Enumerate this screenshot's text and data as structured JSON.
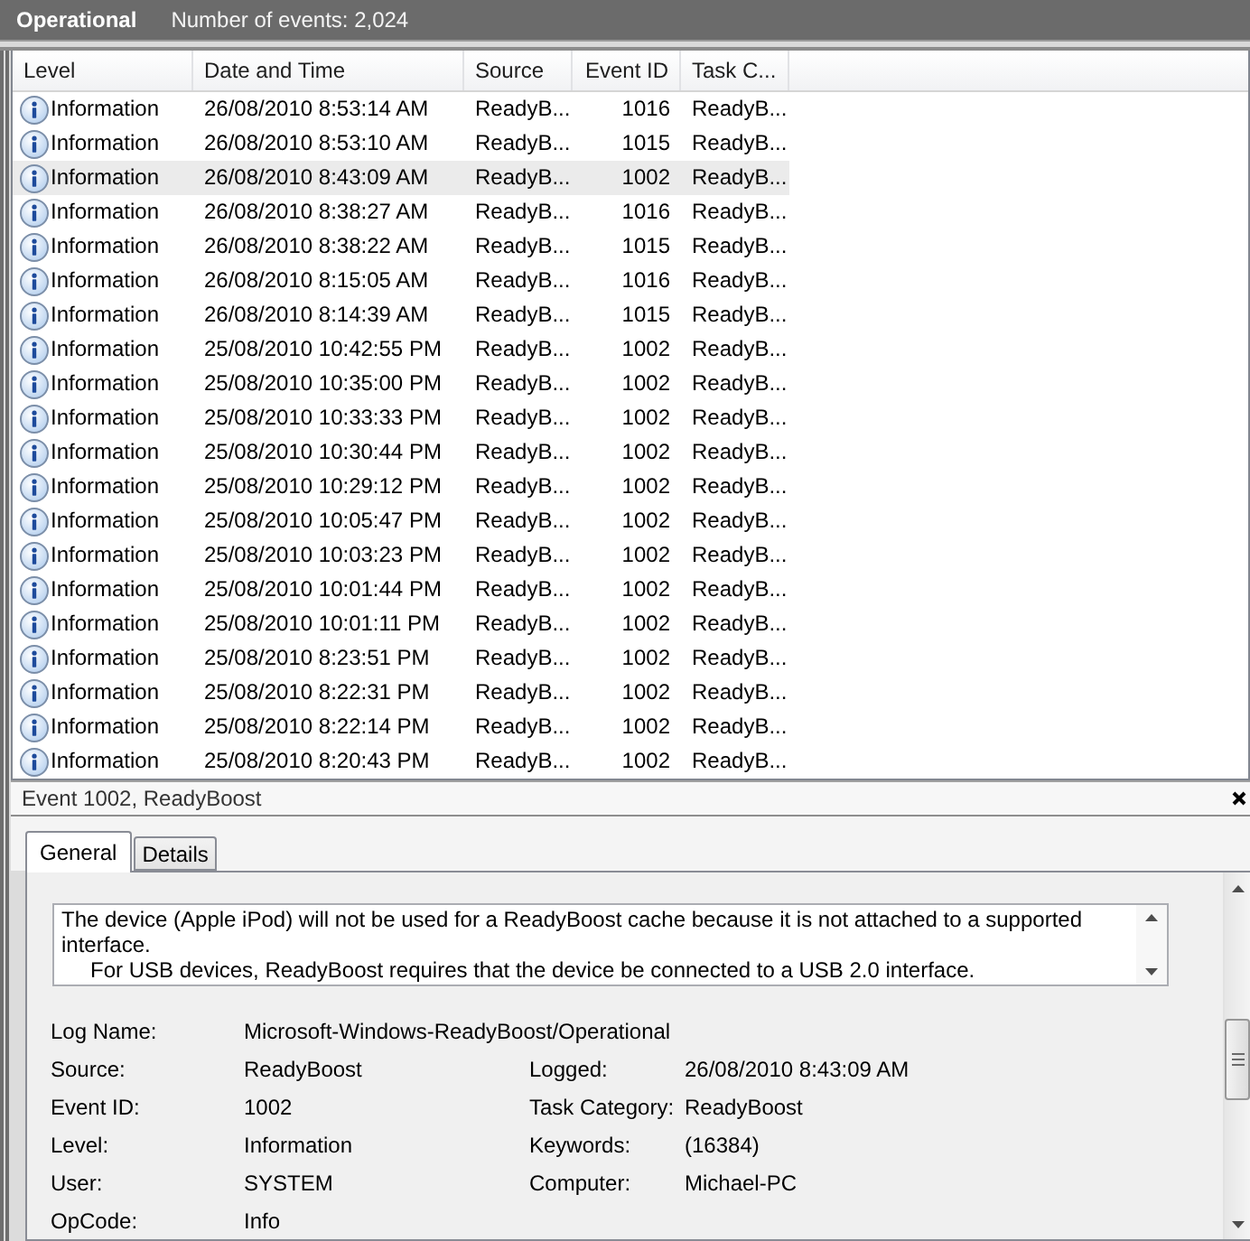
{
  "log_header": {
    "title": "Operational",
    "event_count": "Number of events: 2,024"
  },
  "events_table": {
    "columns": [
      "Level",
      "Date and Time",
      "Source",
      "Event ID",
      "Task C..."
    ],
    "rows": [
      {
        "cells": [
          "Information",
          "26/08/2010 8:53:14 AM",
          "ReadyB...",
          "1016",
          "ReadyB..."
        ],
        "selected": false
      },
      {
        "cells": [
          "Information",
          "26/08/2010 8:53:10 AM",
          "ReadyB...",
          "1015",
          "ReadyB..."
        ],
        "selected": false
      },
      {
        "cells": [
          "Information",
          "26/08/2010 8:43:09 AM",
          "ReadyB...",
          "1002",
          "ReadyB..."
        ],
        "selected": true
      },
      {
        "cells": [
          "Information",
          "26/08/2010 8:38:27 AM",
          "ReadyB...",
          "1016",
          "ReadyB..."
        ],
        "selected": false
      },
      {
        "cells": [
          "Information",
          "26/08/2010 8:38:22 AM",
          "ReadyB...",
          "1015",
          "ReadyB..."
        ],
        "selected": false
      },
      {
        "cells": [
          "Information",
          "26/08/2010 8:15:05 AM",
          "ReadyB...",
          "1016",
          "ReadyB..."
        ],
        "selected": false
      },
      {
        "cells": [
          "Information",
          "26/08/2010 8:14:39 AM",
          "ReadyB...",
          "1015",
          "ReadyB..."
        ],
        "selected": false
      },
      {
        "cells": [
          "Information",
          "25/08/2010 10:42:55 PM",
          "ReadyB...",
          "1002",
          "ReadyB..."
        ],
        "selected": false
      },
      {
        "cells": [
          "Information",
          "25/08/2010 10:35:00 PM",
          "ReadyB...",
          "1002",
          "ReadyB..."
        ],
        "selected": false
      },
      {
        "cells": [
          "Information",
          "25/08/2010 10:33:33 PM",
          "ReadyB...",
          "1002",
          "ReadyB..."
        ],
        "selected": false
      },
      {
        "cells": [
          "Information",
          "25/08/2010 10:30:44 PM",
          "ReadyB...",
          "1002",
          "ReadyB..."
        ],
        "selected": false
      },
      {
        "cells": [
          "Information",
          "25/08/2010 10:29:12 PM",
          "ReadyB...",
          "1002",
          "ReadyB..."
        ],
        "selected": false
      },
      {
        "cells": [
          "Information",
          "25/08/2010 10:05:47 PM",
          "ReadyB...",
          "1002",
          "ReadyB..."
        ],
        "selected": false
      },
      {
        "cells": [
          "Information",
          "25/08/2010 10:03:23 PM",
          "ReadyB...",
          "1002",
          "ReadyB..."
        ],
        "selected": false
      },
      {
        "cells": [
          "Information",
          "25/08/2010 10:01:44 PM",
          "ReadyB...",
          "1002",
          "ReadyB..."
        ],
        "selected": false
      },
      {
        "cells": [
          "Information",
          "25/08/2010 10:01:11 PM",
          "ReadyB...",
          "1002",
          "ReadyB..."
        ],
        "selected": false
      },
      {
        "cells": [
          "Information",
          "25/08/2010 8:23:51 PM",
          "ReadyB...",
          "1002",
          "ReadyB..."
        ],
        "selected": false
      },
      {
        "cells": [
          "Information",
          "25/08/2010 8:22:31 PM",
          "ReadyB...",
          "1002",
          "ReadyB..."
        ],
        "selected": false
      },
      {
        "cells": [
          "Information",
          "25/08/2010 8:22:14 PM",
          "ReadyB...",
          "1002",
          "ReadyB..."
        ],
        "selected": false
      },
      {
        "cells": [
          "Information",
          "25/08/2010 8:20:43 PM",
          "ReadyB...",
          "1002",
          "ReadyB..."
        ],
        "selected": false
      }
    ]
  },
  "event_details": {
    "title": "Event 1002, ReadyBoost",
    "tabs": [
      {
        "label": "General",
        "selected": true
      },
      {
        "label": "Details",
        "selected": false
      }
    ],
    "description": [
      "The device (Apple iPod) will not be used for a ReadyBoost cache because it is not attached to a supported interface.",
      "For USB devices, ReadyBoost requires that the device be connected to a USB 2.0 interface."
    ],
    "field_rows": [
      [
        {
          "label": "Log Name:",
          "value": "Microsoft-Windows-ReadyBoost/Operational"
        }
      ],
      [
        {
          "label": "Source:",
          "value": "ReadyBoost"
        },
        {
          "label": "Logged:",
          "value": "26/08/2010 8:43:09 AM"
        }
      ],
      [
        {
          "label": "Event ID:",
          "value": "1002"
        },
        {
          "label": "Task Category:",
          "value": "ReadyBoost"
        }
      ],
      [
        {
          "label": "Level:",
          "value": "Information"
        },
        {
          "label": "Keywords:",
          "value": "(16384)"
        }
      ],
      [
        {
          "label": "User:",
          "value": "SYSTEM"
        },
        {
          "label": "Computer:",
          "value": "Michael-PC"
        }
      ],
      [
        {
          "label": "OpCode:",
          "value": "Info"
        }
      ]
    ]
  }
}
